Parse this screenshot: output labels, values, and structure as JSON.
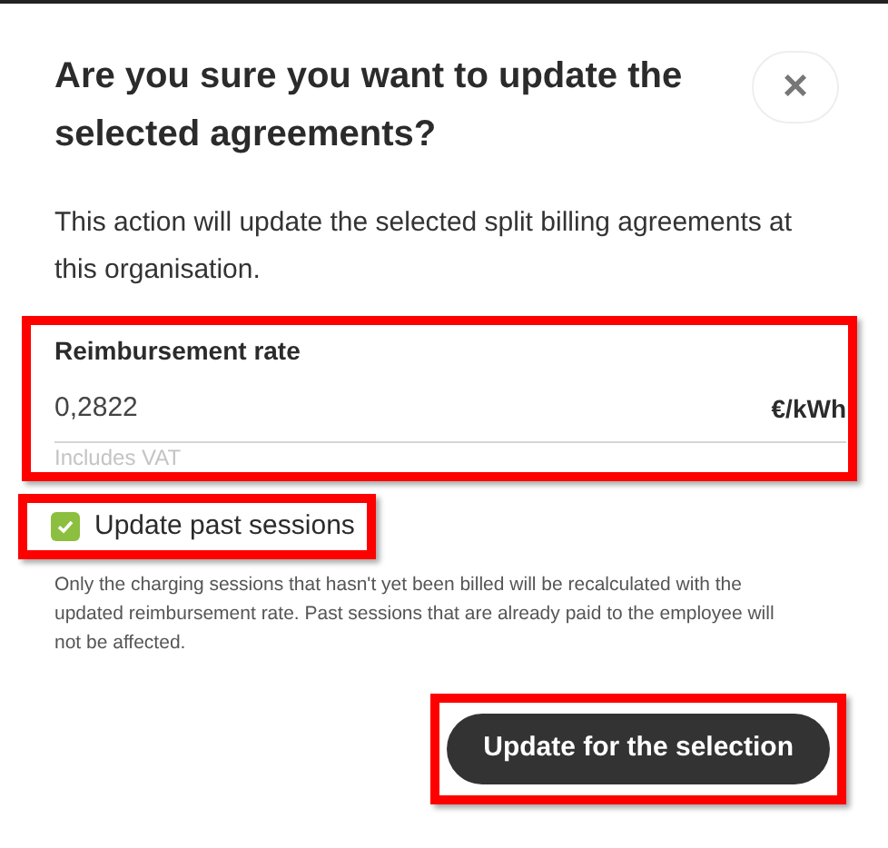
{
  "dialog": {
    "title": "Are you sure you want to update the selected agreements?",
    "close_label": "×",
    "description": "This action will update the selected split billing agreements at this organisation."
  },
  "rate_field": {
    "label": "Reimbursement rate",
    "value": "0,2822",
    "unit": "€/kWh",
    "hint": "Includes VAT",
    "highlighted": true
  },
  "past_sessions": {
    "label": "Update past sessions",
    "checked": true,
    "highlighted": true
  },
  "note": "Only the charging sessions that hasn't yet been billed will be recalculated with the updated reimbursement rate. Past sessions that are already paid to the employee will not be affected.",
  "confirm_button": {
    "label": "Update for the selection",
    "highlighted": true
  }
}
